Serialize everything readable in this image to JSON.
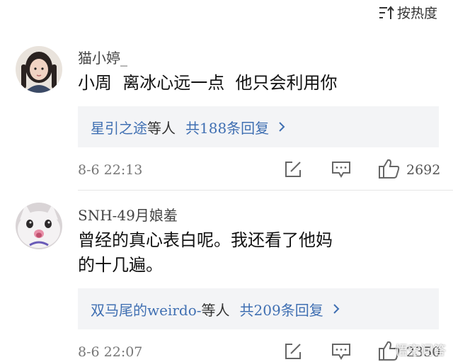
{
  "sort": {
    "label": "按热度",
    "icon": "sort-icon"
  },
  "comments": [
    {
      "username": "猫小婷_",
      "content": "小周  离冰心远一点  他只会利用你",
      "reply_users": "星引之途",
      "reply_suffix": "等人",
      "reply_count": "共188条回复",
      "timestamp": "8-6 22:13",
      "likes": "2692"
    },
    {
      "username": "SNH-49月娘羞",
      "content_line1": "曾经的真心表白呢。我还看了他妈",
      "content_line2": "的十几遍。",
      "reply_users": "双马尾的weirdo-",
      "reply_suffix": "等人",
      "reply_count": "共209条回复",
      "timestamp": "8-6 22:07",
      "likes": "2350"
    }
  ],
  "watermark": "悟空问答",
  "colors": {
    "link": "#3f6fb2",
    "reply_bg": "#f3f4f6",
    "divider": "#e6e6e6"
  }
}
